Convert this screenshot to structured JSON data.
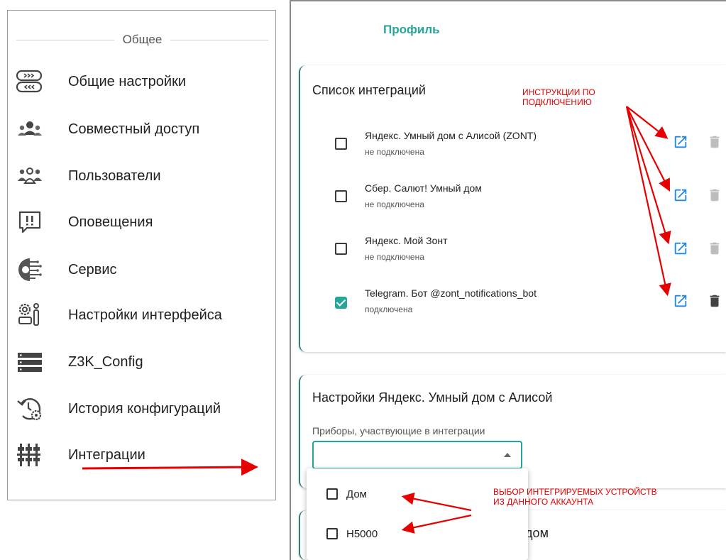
{
  "menu": {
    "section_title": "Общее",
    "items": [
      {
        "label": "Общие настройки",
        "icon": "toggles-icon"
      },
      {
        "label": "Совместный доступ",
        "icon": "shared-access-icon"
      },
      {
        "label": "Пользователи",
        "icon": "users-icon"
      },
      {
        "label": "Оповещения",
        "icon": "alerts-icon"
      },
      {
        "label": "Сервис",
        "icon": "service-icon"
      },
      {
        "label": "Настройки интерфейса",
        "icon": "interface-settings-icon"
      },
      {
        "label": "Z3K_Config",
        "icon": "server-icon"
      },
      {
        "label": "История конфигураций",
        "icon": "history-icon"
      },
      {
        "label": "Интеграции",
        "icon": "integrations-icon"
      }
    ]
  },
  "profile_tab": "Профиль",
  "integrations_card": {
    "title": "Список интеграций",
    "items": [
      {
        "name": "Яндекс. Умный дом с Алисой (ZONT)",
        "status": "не подключена",
        "checked": false
      },
      {
        "name": "Сбер. Салют! Умный дом",
        "status": "не подключена",
        "checked": false
      },
      {
        "name": "Яндекс. Мой Зонт",
        "status": "не подключена",
        "checked": false
      },
      {
        "name": "Telegram. Бот @zont_notifications_bot",
        "status": "подключена",
        "checked": true
      }
    ]
  },
  "settings_card": {
    "title": "Настройки Яндекс. Умный дом с Алисой",
    "field_label": "Приборы, участвующие в интеграции",
    "select_value": "",
    "options": [
      {
        "label": "Дом",
        "checked": false
      },
      {
        "label": "H5000",
        "checked": false
      }
    ]
  },
  "third_card_title_fragment": "й дом",
  "annotations": {
    "instructions_line1": "ИНСТРУКЦИИ ПО",
    "instructions_line2": "ПОДКЛЮЧЕНИЮ",
    "devices_line1": "ВЫБОР ИНТЕГРИРУЕМЫХ УСТРОЙСТВ",
    "devices_line2": "ИЗ ДАННОГО АККАУНТА"
  },
  "colors": {
    "accent": "#26a69a",
    "link_icon": "#1e88e5",
    "annotation": "#e60000",
    "trash_disabled": "#bdbdbd",
    "trash_enabled": "#424242"
  }
}
